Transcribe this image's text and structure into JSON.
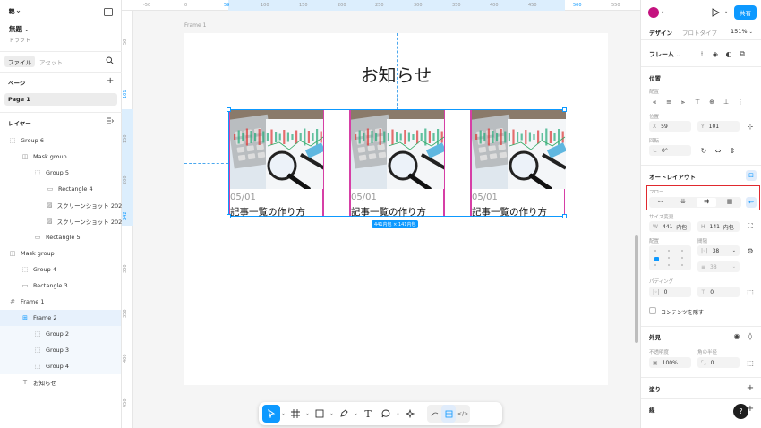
{
  "app": {
    "share_label": "共有",
    "zoom": "151%",
    "help_label": "?"
  },
  "left": {
    "file_name": "無題",
    "file_sub": "ドラフト",
    "tabs": [
      "ファイル",
      "アセット"
    ],
    "pages_header": "ページ",
    "page1": "Page 1",
    "layers_header": "レイヤー",
    "layers": [
      {
        "name": "Group 6",
        "icon": "group-icon"
      },
      {
        "name": "Mask group",
        "icon": "mask-icon"
      },
      {
        "name": "Group 5",
        "icon": "group-icon"
      },
      {
        "name": "Rectangle 4",
        "icon": "rectangle-icon"
      },
      {
        "name": "スクリーンショット 2025...",
        "icon": "image-icon"
      },
      {
        "name": "スクリーンショット 2025...",
        "icon": "image-icon"
      },
      {
        "name": "Rectangle 5",
        "icon": "rectangle-icon"
      },
      {
        "name": "Mask group",
        "icon": "mask-icon"
      },
      {
        "name": "Group 4",
        "icon": "group-icon"
      },
      {
        "name": "Rectangle 3",
        "icon": "rectangle-icon"
      },
      {
        "name": "Frame 1",
        "icon": "frame-icon"
      },
      {
        "name": "Frame 2",
        "icon": "auto-layout-icon"
      },
      {
        "name": "Group 2",
        "icon": "group-icon"
      },
      {
        "name": "Group 3",
        "icon": "group-icon"
      },
      {
        "name": "Group 4",
        "icon": "group-icon"
      },
      {
        "name": "お知らせ",
        "icon": "text-icon"
      }
    ]
  },
  "ruler": {
    "h": [
      "-50",
      "0",
      "59",
      "100",
      "150",
      "200",
      "250",
      "300",
      "350",
      "400",
      "450",
      "500",
      "550"
    ],
    "v": [
      "50",
      "101",
      "150",
      "200",
      "242",
      "300",
      "350",
      "400",
      "450",
      "500"
    ]
  },
  "canvas": {
    "frame_label": "Frame 1",
    "heading": "お知らせ",
    "size_badge": "441内包 × 141内包",
    "cards": [
      {
        "date": "05/01",
        "title": "記事一覧の作り方"
      },
      {
        "date": "05/01",
        "title": "記事一覧の作り方"
      },
      {
        "date": "05/01",
        "title": "記事一覧の作り方"
      }
    ]
  },
  "right": {
    "tabs": [
      "デザイン",
      "プロトタイプ"
    ],
    "frame_label": "フレーム",
    "position_header": "位置",
    "align_label": "配置",
    "position_label": "位置",
    "x": "59",
    "y": "101",
    "rotation_label": "回転",
    "rotation": "0°",
    "autolayout_header": "オートレイアウト",
    "flow_label": "フロー",
    "size_label": "サイズ変更",
    "w": "441",
    "w_mode": "内包",
    "h": "141",
    "h_mode": "内包",
    "align2_label": "配置",
    "gap_label": "間隔",
    "gap": "38",
    "gap2": "38",
    "padding_label": "パディング",
    "pad_h": "0",
    "pad_v": "0",
    "clip_label": "コンテンツを隠す",
    "appearance_header": "外見",
    "opacity_label": "不透明度",
    "radius_label": "角の半径",
    "opacity": "100%",
    "radius": "0",
    "fill_header": "塗り",
    "stroke_header": "線"
  },
  "colors": {
    "accent": "#0d99ff",
    "card_border": "#d63fa6",
    "flow_highlight": "#e0292e"
  }
}
